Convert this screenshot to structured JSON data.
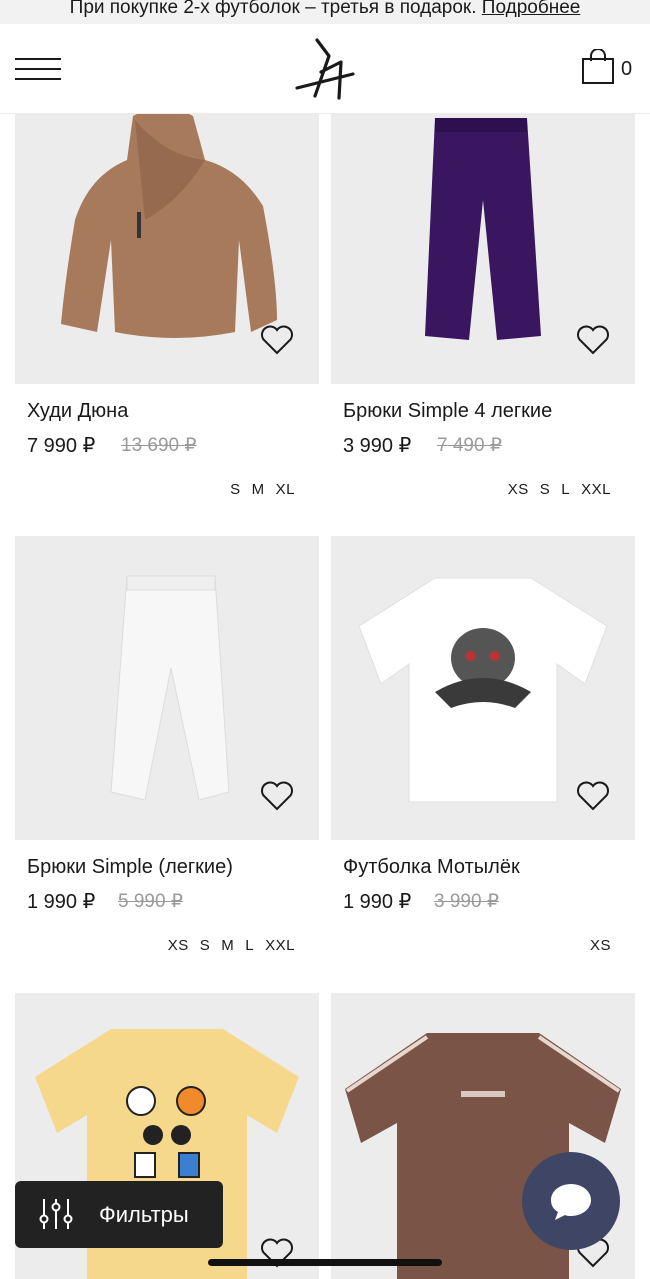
{
  "promo": {
    "text": "При покупке 2-х футболок – третья в подарок. ",
    "link": "Подробнее"
  },
  "header": {
    "cart_count": "0"
  },
  "products": [
    {
      "name": "Худи Дюна",
      "price": "7 990 ₽",
      "old_price": "13 690 ₽",
      "sizes": [
        "S",
        "M",
        "XL"
      ],
      "color": "#a77a5c"
    },
    {
      "name": "Брюки Simple 4 легкие",
      "price": "3 990 ₽",
      "old_price": "7 490 ₽",
      "sizes": [
        "XS",
        "S",
        "L",
        "XXL"
      ],
      "color": "#3b1660"
    },
    {
      "name": "Брюки Simple (легкие)",
      "price": "1 990 ₽",
      "old_price": "5 990 ₽",
      "sizes": [
        "XS",
        "S",
        "M",
        "L",
        "XXL"
      ],
      "color": "#f4f4f4"
    },
    {
      "name": "Футболка Мотылёк",
      "price": "1 990 ₽",
      "old_price": "3 990 ₽",
      "sizes": [
        "XS"
      ],
      "color": "#ffffff"
    },
    {
      "name": "",
      "price": "",
      "old_price": "",
      "sizes": [],
      "color": "#f6d88c"
    },
    {
      "name": "",
      "price": "",
      "old_price": "",
      "sizes": [],
      "color": "#7a5446"
    }
  ],
  "filters_button": {
    "label": "Фильтры"
  }
}
